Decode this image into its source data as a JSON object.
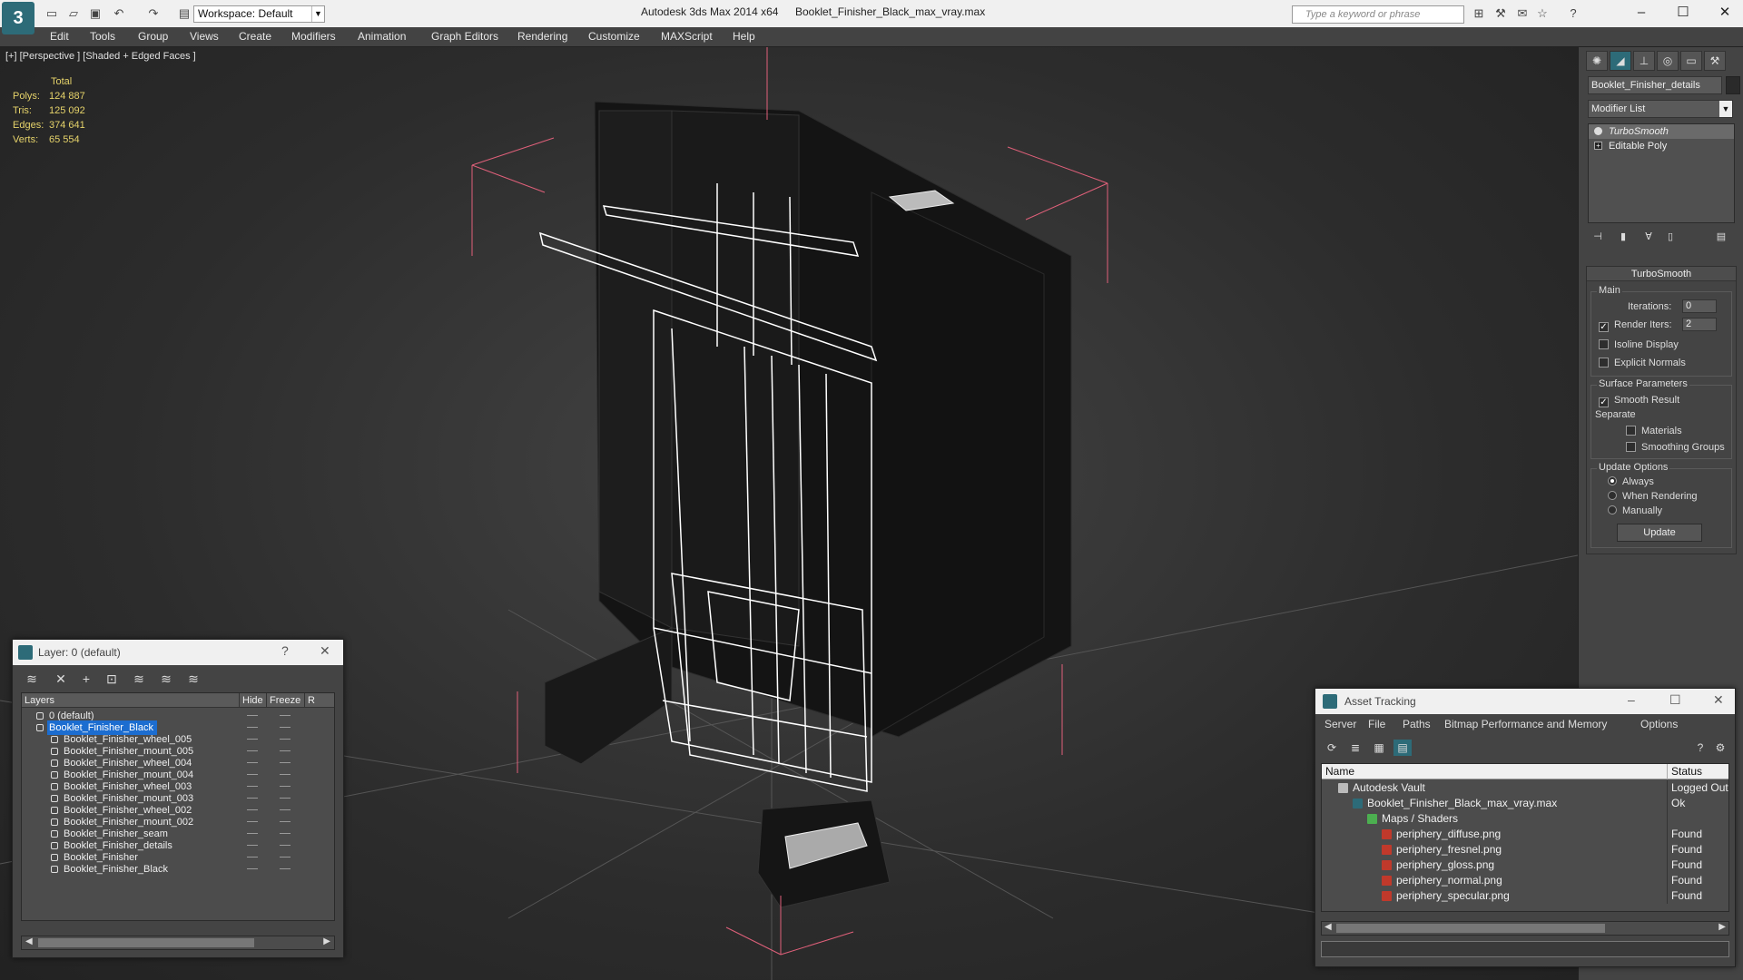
{
  "titlebar": {
    "workspace": "Workspace: Default",
    "app_title": "Autodesk 3ds Max  2014 x64",
    "file_title": "Booklet_Finisher_Black_max_vray.max",
    "search_placeholder": "Type a keyword or phrase"
  },
  "menu": [
    "Edit",
    "Tools",
    "Group",
    "Views",
    "Create",
    "Modifiers",
    "Animation",
    "Graph Editors",
    "Rendering",
    "Customize",
    "MAXScript",
    "Help"
  ],
  "viewport": {
    "label": "[+] [Perspective ] [Shaded + Edged Faces ]",
    "stats_header": "Total",
    "stats": [
      {
        "key": "Polys:",
        "value": "124 887"
      },
      {
        "key": "Tris:",
        "value": "125 092"
      },
      {
        "key": "Edges:",
        "value": "374 641"
      },
      {
        "key": "Verts:",
        "value": "65 554"
      }
    ]
  },
  "command_panel": {
    "object_name": "Booklet_Finisher_details",
    "modifier_list": "Modifier List",
    "stack": [
      "TurboSmooth",
      "Editable Poly"
    ],
    "rollout_title": "TurboSmooth",
    "main_group": "Main",
    "iterations_label": "Iterations:",
    "iterations_value": "0",
    "render_iters_label": "Render Iters:",
    "render_iters_value": "2",
    "render_iters_checked": true,
    "isoline_label": "Isoline Display",
    "explicit_normals_label": "Explicit Normals",
    "surface_group": "Surface Parameters",
    "smooth_result_label": "Smooth Result",
    "separate_label": "Separate",
    "materials_label": "Materials",
    "smoothing_groups_label": "Smoothing Groups",
    "update_group": "Update Options",
    "always_label": "Always",
    "when_rendering_label": "When Rendering",
    "manually_label": "Manually",
    "update_button": "Update"
  },
  "layer_dialog": {
    "title": "Layer: 0 (default)",
    "help": "?",
    "columns": {
      "layers": "Layers",
      "hide": "Hide",
      "freeze": "Freeze",
      "render": "R"
    },
    "rows": [
      {
        "name": "0 (default)",
        "level": 0
      },
      {
        "name": "Booklet_Finisher_Black",
        "level": 0,
        "selected": true
      },
      {
        "name": "Booklet_Finisher_wheel_005",
        "level": 1
      },
      {
        "name": "Booklet_Finisher_mount_005",
        "level": 1
      },
      {
        "name": "Booklet_Finisher_wheel_004",
        "level": 1
      },
      {
        "name": "Booklet_Finisher_mount_004",
        "level": 1
      },
      {
        "name": "Booklet_Finisher_wheel_003",
        "level": 1
      },
      {
        "name": "Booklet_Finisher_mount_003",
        "level": 1
      },
      {
        "name": "Booklet_Finisher_wheel_002",
        "level": 1
      },
      {
        "name": "Booklet_Finisher_mount_002",
        "level": 1
      },
      {
        "name": "Booklet_Finisher_seam",
        "level": 1
      },
      {
        "name": "Booklet_Finisher_details",
        "level": 1
      },
      {
        "name": "Booklet_Finisher",
        "level": 1
      },
      {
        "name": "Booklet_Finisher_Black",
        "level": 1
      }
    ]
  },
  "asset_dialog": {
    "title": "Asset Tracking",
    "menu": [
      "Server",
      "File",
      "Paths",
      "Bitmap Performance and Memory",
      "Options"
    ],
    "columns": {
      "name": "Name",
      "status": "Status"
    },
    "rows": [
      {
        "name": "Autodesk Vault",
        "status": "Logged Out",
        "level": 0,
        "icon": "vault-icon"
      },
      {
        "name": "Booklet_Finisher_Black_max_vray.max",
        "status": "Ok",
        "level": 1,
        "icon": "max-file-icon"
      },
      {
        "name": "Maps / Shaders",
        "status": "",
        "level": 2,
        "icon": "maps-icon"
      },
      {
        "name": "periphery_diffuse.png",
        "status": "Found",
        "level": 3,
        "icon": "png-icon"
      },
      {
        "name": "periphery_fresnel.png",
        "status": "Found",
        "level": 3,
        "icon": "png-icon"
      },
      {
        "name": "periphery_gloss.png",
        "status": "Found",
        "level": 3,
        "icon": "png-icon"
      },
      {
        "name": "periphery_normal.png",
        "status": "Found",
        "level": 3,
        "icon": "png-icon"
      },
      {
        "name": "periphery_specular.png",
        "status": "Found",
        "level": 3,
        "icon": "png-icon"
      }
    ]
  },
  "colors": {
    "stats": "#e6d36a",
    "selection": "#1c6dd0",
    "bounding_box": "#e0607a",
    "wireframe": "#ffffff"
  }
}
